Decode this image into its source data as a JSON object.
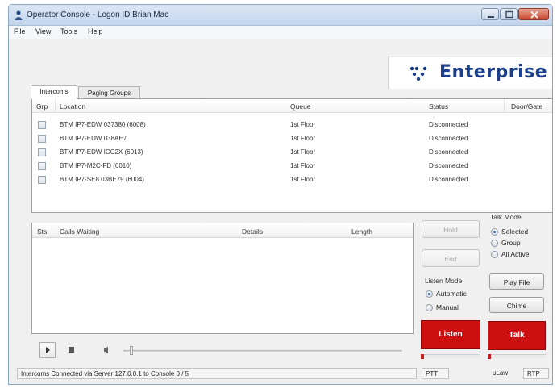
{
  "window": {
    "title": "Operator Console - Logon ID Brian Mac"
  },
  "menu": [
    "File",
    "View",
    "Tools",
    "Help"
  ],
  "logo": {
    "text": "Enterprise"
  },
  "tabs": [
    {
      "label": "Intercoms",
      "active": true
    },
    {
      "label": "Paging Groups",
      "active": false
    }
  ],
  "intercoms": {
    "columns": [
      "Grp",
      "Location",
      "Queue",
      "Status",
      "Door/Gate"
    ],
    "rows": [
      {
        "location": "BTM IP7-EDW 037380 (6008)",
        "queue": "1st Floor",
        "status": "Disconnected"
      },
      {
        "location": "BTM IP7-EDW 038AE7",
        "queue": "1st Floor",
        "status": "Disconnected"
      },
      {
        "location": "BTM IP7-EDW ICC2X (6013)",
        "queue": "1st Floor",
        "status": "Disconnected"
      },
      {
        "location": "BTM IP7-M2C-FD (6010)",
        "queue": "1st Floor",
        "status": "Disconnected"
      },
      {
        "location": "BTM IP7-SE8 03BE79 (6004)",
        "queue": "1st Floor",
        "status": "Disconnected"
      }
    ]
  },
  "calls": {
    "columns": [
      "Sts",
      "Calls Waiting",
      "Details",
      "Length"
    ]
  },
  "controls": {
    "hold": "Hold",
    "end": "End",
    "talk_mode": {
      "label": "Talk Mode",
      "options": [
        "Selected",
        "Group",
        "All Active"
      ],
      "selected": "Selected"
    },
    "listen_mode": {
      "label": "Listen Mode",
      "options": [
        "Automatic",
        "Manual"
      ],
      "selected": "Automatic"
    },
    "play_file": "Play File",
    "chime": "Chime",
    "listen": "Listen",
    "talk": "Talk"
  },
  "status_bar": {
    "message": "Intercoms Connected via Server 127.0.0.1 to Console 0 / 5",
    "ptt": "PTT",
    "codec": "uLaw",
    "protocol": "RTP"
  },
  "colors": {
    "accent_red": "#cc1010",
    "logo_blue": "#1b3f8f",
    "title_bar": "#c3d5ec"
  },
  "icons": [
    "user-icon",
    "minimize-icon",
    "maximize-icon",
    "close-icon",
    "play-icon",
    "stop-icon",
    "volume-icon"
  ]
}
